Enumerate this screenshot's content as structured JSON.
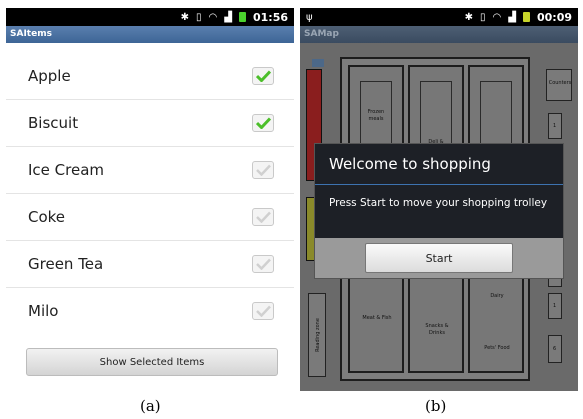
{
  "panel_a": {
    "status": {
      "time": "01:56"
    },
    "app_title": "SAItems",
    "items": [
      {
        "label": "Apple",
        "checked": true
      },
      {
        "label": "Biscuit",
        "checked": true
      },
      {
        "label": "Ice Cream",
        "checked": false
      },
      {
        "label": "Coke",
        "checked": false
      },
      {
        "label": "Green Tea",
        "checked": false
      },
      {
        "label": "Milo",
        "checked": false
      }
    ],
    "show_button": "Show Selected Items",
    "caption": "(a)"
  },
  "panel_b": {
    "status": {
      "time": "00:09"
    },
    "app_title": "SAMap",
    "map_labels": {
      "frozen": "Frozen meals",
      "deli": "Deli &",
      "dairy": "Dairy",
      "meat": "Meat & Fish",
      "snacks": "Snacks & Drinks",
      "pets": "Pets' Food",
      "counters": "Counters",
      "reading": "Reading zone",
      "side_numbers": [
        "1",
        "1",
        "1",
        "6"
      ]
    },
    "dialog": {
      "title": "Welcome to shopping",
      "message": "Press Start to move your shopping trolley",
      "start_button": "Start"
    },
    "caption": "(b)"
  },
  "colors": {
    "check_green": "#4cbf2a",
    "check_gray": "#c4c4c4",
    "titlebar_blue": "#3d6596",
    "dialog_bg": "#1d2026",
    "dialog_divider": "#3d73b0"
  },
  "icons": [
    "bluetooth-icon",
    "vibrate-icon",
    "wifi-icon",
    "signal-icon",
    "battery-icon",
    "usb-icon",
    "check-icon"
  ]
}
